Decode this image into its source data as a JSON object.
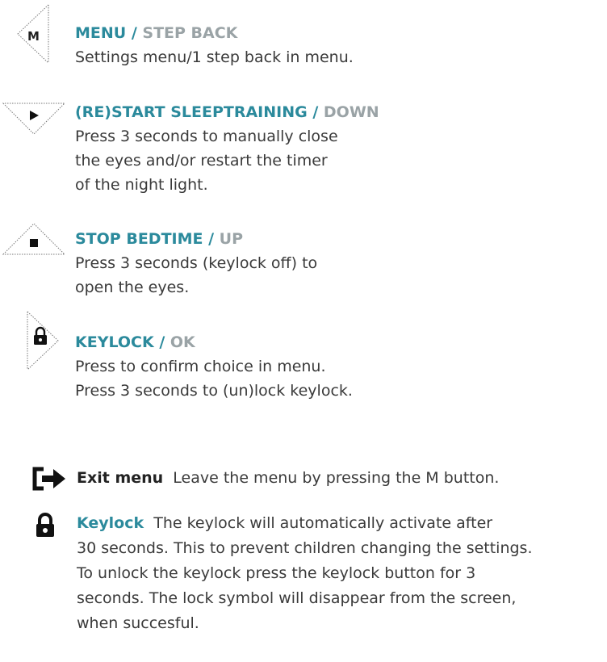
{
  "buttons": [
    {
      "icon": "m-button-icon",
      "icon_letter": "M",
      "title": "MENU",
      "alt": "STEP BACK",
      "lines": [
        "Settings menu/1 step back in menu."
      ]
    },
    {
      "icon": "play-down-button-icon",
      "title": "(RE)START SLEEPTRAINING",
      "alt": "DOWN",
      "lines": [
        "Press 3 seconds to manually close",
        "the eyes and/or restart the timer",
        "of the night light."
      ]
    },
    {
      "icon": "stop-up-button-icon",
      "title": "STOP BEDTIME",
      "alt": "UP",
      "lines": [
        "Press 3 seconds (keylock off) to",
        "open the eyes."
      ]
    },
    {
      "icon": "lock-ok-button-icon",
      "title": "KEYLOCK",
      "alt": "OK",
      "lines": [
        "Press to confirm choice in menu.",
        "Press 3 seconds to (un)lock keylock."
      ]
    }
  ],
  "separator": " / ",
  "notes": [
    {
      "icon": "exit-icon",
      "lead": "Exit menu",
      "lines": [
        "Leave the menu by pressing the M button."
      ]
    },
    {
      "icon": "lock-icon",
      "lead": "Keylock",
      "lines": [
        "The keylock will automatically activate after",
        "30 seconds. This to prevent children changing the settings.",
        "To unlock the keylock press the keylock button for 3",
        "seconds. The lock symbol will disappear from the screen,",
        "when succesful."
      ]
    }
  ],
  "colors": {
    "accent": "#2b8a9c",
    "muted": "#9aa3a6",
    "text": "#3a3a3a"
  }
}
